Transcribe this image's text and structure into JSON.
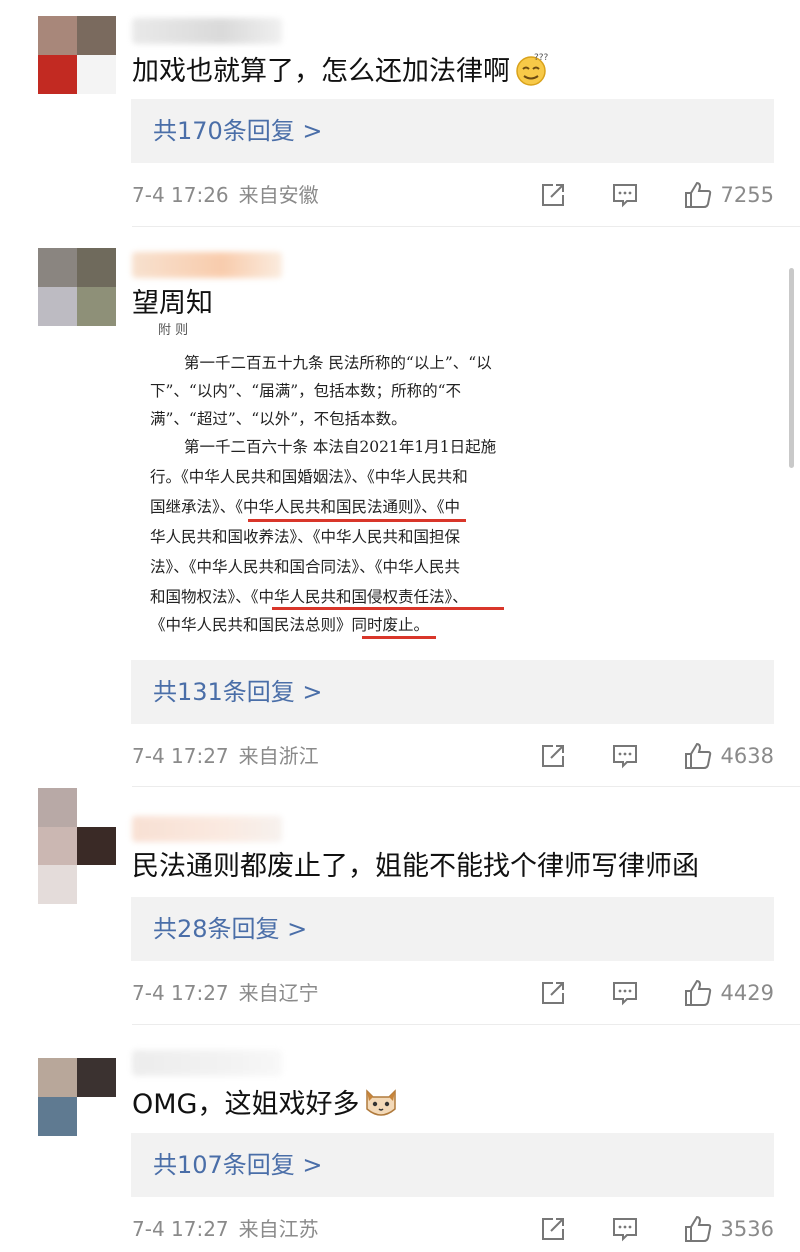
{
  "comments": [
    {
      "text": "加戏也就算了，怎么还加法律啊",
      "emoji": "sweat-smile-emoji",
      "replies": "共170条回复 >",
      "date": "7-4 17:26",
      "location": "来自安徽",
      "likes": "7255"
    },
    {
      "text": "望周知",
      "replies": "共131条回复 >",
      "date": "7-4 17:27",
      "location": "来自浙江",
      "likes": "4638"
    },
    {
      "text": "民法通则都废止了，姐能不能找个律师写律师函",
      "replies": "共28条回复 >",
      "date": "7-4 17:27",
      "location": "来自辽宁",
      "likes": "4429"
    },
    {
      "text": "OMG，这姐戏好多",
      "emoji": "cat-face-emoji",
      "replies": "共107条回复 >",
      "date": "7-4 17:27",
      "location": "来自江苏",
      "likes": "3536"
    }
  ],
  "law_image": {
    "lines": [
      "附 则",
      "第一千二百五十九条 民法所称的“以上”、“以",
      "下”、“以内”、“届满”，包括本数；所称的“不",
      "满”、“超过”、“以外”，不包括本数。",
      "第一千二百六十条 本法自2021年1月1日起施",
      "行。《中华人民共和国婚姻法》、《中华人民共和",
      "国继承法》、《中华人民共和国民法通则》、《中",
      "华人民共和国收养法》、《中华人民共和国担保",
      "法》、《中华人民共和国合同法》、《中华人民共",
      "和国物权法》、《中华人民共和国侵权责任法》、",
      "《中华人民共和国民法总则》同时废止。"
    ],
    "underline_color": "#d9362a"
  },
  "colors": {
    "reply_link": "#4a6ea8",
    "reply_bg": "#f2f2f2",
    "meta_gray": "#8a8a8a"
  },
  "icons": [
    "share-icon",
    "comment-icon",
    "like-icon"
  ]
}
